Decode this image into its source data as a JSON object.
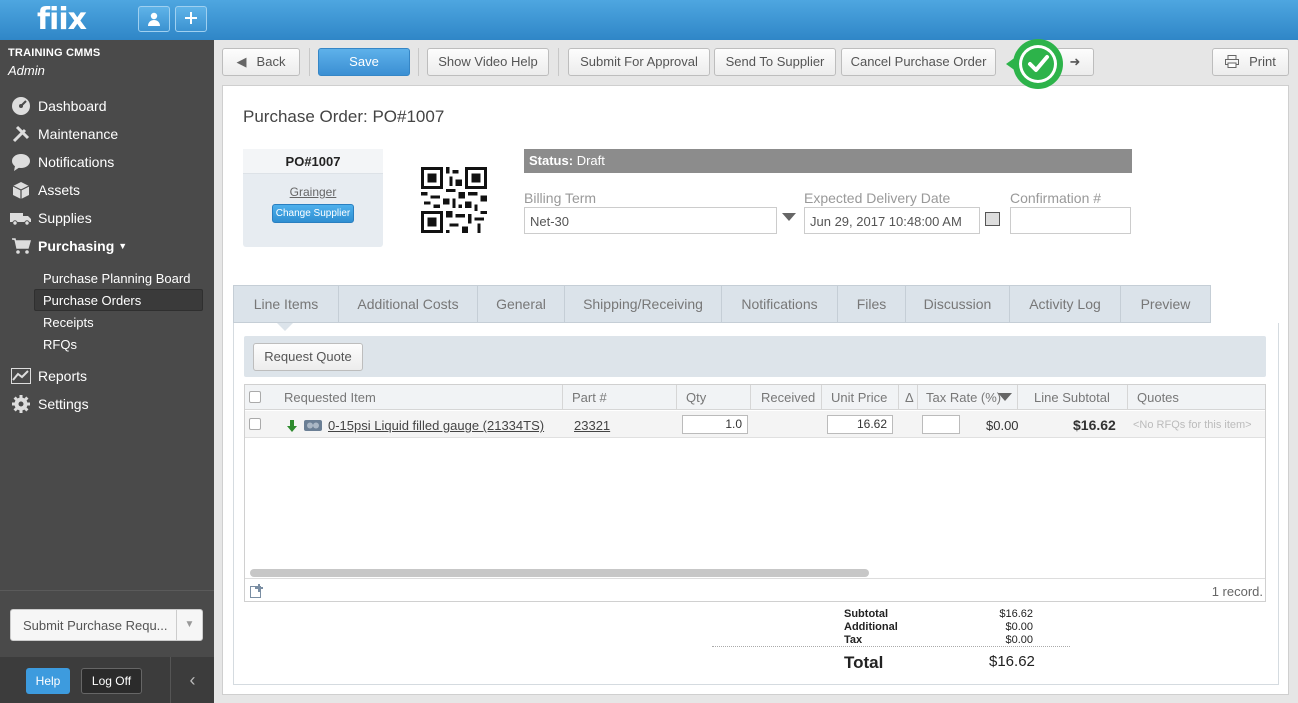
{
  "app": {
    "logo": "fiix"
  },
  "sidebar": {
    "org": "TRAINING CMMS",
    "user": "Admin",
    "nav": [
      {
        "label": "Dashboard",
        "icon": "dashboard-icon"
      },
      {
        "label": "Maintenance",
        "icon": "wrench-icon"
      },
      {
        "label": "Notifications",
        "icon": "chat-bubble-icon"
      },
      {
        "label": "Assets",
        "icon": "box-icon"
      },
      {
        "label": "Supplies",
        "icon": "truck-icon"
      },
      {
        "label": "Purchasing",
        "icon": "cart-icon"
      },
      {
        "label": "Reports",
        "icon": "chart-icon"
      },
      {
        "label": "Settings",
        "icon": "gear-icon"
      }
    ],
    "purchasing_sub": [
      "Purchase Planning Board",
      "Purchase Orders",
      "Receipts",
      "RFQs"
    ],
    "submit_request": "Submit Purchase Requ...",
    "help": "Help",
    "logoff": "Log Off"
  },
  "toolbar": {
    "back": "Back",
    "save": "Save",
    "video_help": "Show Video Help",
    "submit_approval": "Submit For Approval",
    "send_supplier": "Send To Supplier",
    "cancel_po": "Cancel Purchase Order",
    "print": "Print"
  },
  "po": {
    "title": "Purchase Order: PO#1007",
    "number": "PO#1007",
    "supplier": "Grainger",
    "change_supplier": "Change Supplier",
    "status_label": "Status:",
    "status_value": "Draft",
    "billing_term_label": "Billing Term",
    "billing_term": "Net-30",
    "delivery_label": "Expected Delivery Date",
    "delivery_date": "Jun 29, 2017 10:48:00 AM",
    "confirmation_label": "Confirmation #",
    "confirmation": ""
  },
  "tabs": [
    "Line Items",
    "Additional Costs",
    "General",
    "Shipping/Receiving",
    "Notifications",
    "Files",
    "Discussion",
    "Activity Log",
    "Preview"
  ],
  "grid": {
    "request_quote": "Request Quote",
    "headers": {
      "item": "Requested Item",
      "part": "Part #",
      "qty": "Qty",
      "received": "Received",
      "unit_price": "Unit Price",
      "delta": "Δ",
      "tax_rate": "Tax Rate (%)",
      "line_subtotal": "Line Subtotal",
      "quotes": "Quotes"
    },
    "rows": [
      {
        "item": "0-15psi Liquid filled gauge (21334TS)",
        "part": "23321",
        "qty": "1.0",
        "unit_price": "16.62",
        "tax_amount": "$0.00",
        "line_subtotal": "$16.62",
        "quotes": "<No RFQs for this item>"
      }
    ],
    "records": "1 record."
  },
  "totals": {
    "subtotal_label": "Subtotal",
    "subtotal": "$16.62",
    "additional_label": "Additional",
    "additional": "$0.00",
    "tax_label": "Tax",
    "tax": "$0.00",
    "total_label": "Total",
    "total": "$16.62"
  },
  "colors": {
    "brand": "#3b95d6",
    "sidebar": "#4a4a4a",
    "status": "#8c8c8c",
    "check": "#2db34a"
  }
}
